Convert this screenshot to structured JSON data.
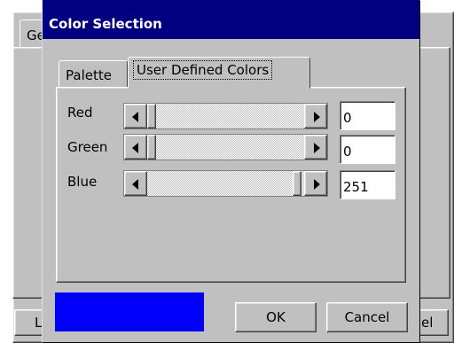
{
  "background_window": {
    "tab_label_fragment": "Ge",
    "left_button_fragment": "L",
    "right_button_fragment": "el"
  },
  "dialog": {
    "title": "Color Selection",
    "tabs": [
      {
        "label": "Palette",
        "active": false
      },
      {
        "label": "User Defined Colors",
        "active": true
      }
    ],
    "channels": [
      {
        "label": "Red",
        "value": "0",
        "level_fraction": 0.0
      },
      {
        "label": "Green",
        "value": "0",
        "level_fraction": 0.0
      },
      {
        "label": "Blue",
        "value": "251",
        "level_fraction": 0.984
      }
    ],
    "preview_color": "#0000fb",
    "buttons": {
      "ok": "OK",
      "cancel": "Cancel"
    }
  },
  "colors": {
    "titlebar": "#000080",
    "face": "#c0c0c0",
    "desktop": "#ffffff"
  }
}
